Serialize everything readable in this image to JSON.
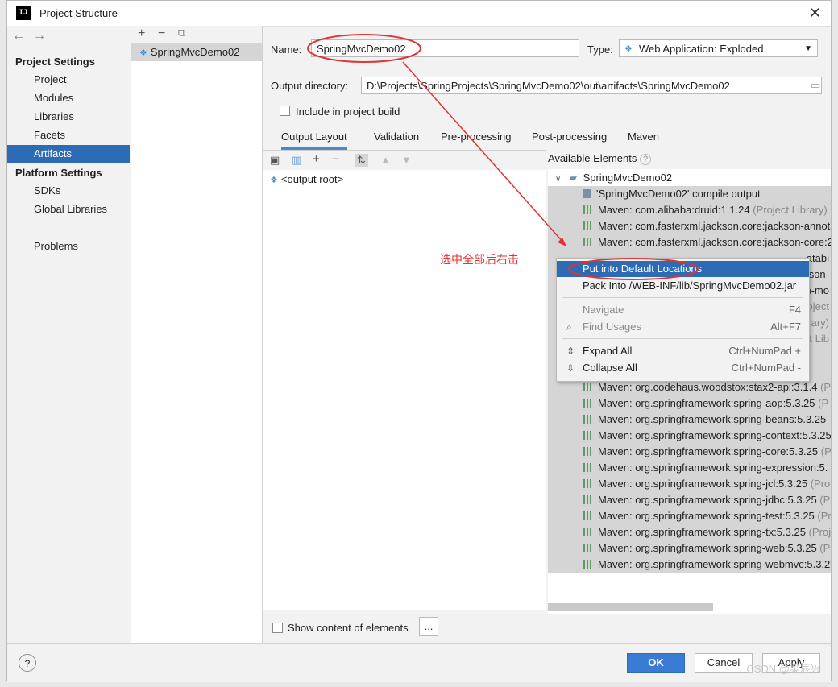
{
  "window": {
    "title": "Project Structure",
    "app_icon": "IJ"
  },
  "nav": {
    "project_settings": "Project Settings",
    "items_ps": [
      "Project",
      "Modules",
      "Libraries",
      "Facets",
      "Artifacts"
    ],
    "platform_settings": "Platform Settings",
    "items_platform": [
      "SDKs",
      "Global Libraries"
    ],
    "problems": "Problems",
    "selected": "Artifacts"
  },
  "artifact_list": {
    "item": "SpringMvcDemo02"
  },
  "form": {
    "name_label": "Name:",
    "name_value": "SpringMvcDemo02",
    "type_label": "Type:",
    "type_value": "Web Application: Exploded",
    "output_label": "Output directory:",
    "output_value": "D:\\Projects\\SpringProjects\\SpringMvcDemo02\\out\\artifacts\\SpringMvcDemo02",
    "include_label": "Include in project build"
  },
  "tabs": [
    "Output Layout",
    "Validation",
    "Pre-processing",
    "Post-processing",
    "Maven"
  ],
  "layout": {
    "root": "<output root>"
  },
  "available": {
    "label": "Available Elements",
    "project": "SpringMvcDemo02",
    "rows": [
      {
        "text": "'SpringMvcDemo02' compile output",
        "suffix": ""
      },
      {
        "text": "Maven: com.alibaba:druid:1.1.24",
        "suffix": " (Project Library)"
      },
      {
        "text": "Maven: com.fasterxml.jackson.core:jackson-annota",
        "suffix": ""
      },
      {
        "text": "Maven: com.fasterxml.jackson.core:jackson-core:2",
        "suffix": ""
      },
      {
        "text": "Maven: org.codehaus.woodstox:stax2-api:3.1.4",
        "suffix": " (Pr"
      },
      {
        "text": "Maven: org.springframework:spring-aop:5.3.25",
        "suffix": " (P"
      },
      {
        "text": "Maven: org.springframework:spring-beans:5.3.25",
        "suffix": ""
      },
      {
        "text": "Maven: org.springframework:spring-context:5.3.25",
        "suffix": ""
      },
      {
        "text": "Maven: org.springframework:spring-core:5.3.25",
        "suffix": " (Pr"
      },
      {
        "text": "Maven: org.springframework:spring-expression:5.",
        "suffix": ""
      },
      {
        "text": "Maven: org.springframework:spring-jcl:5.3.25",
        "suffix": " (Pro"
      },
      {
        "text": "Maven: org.springframework:spring-jdbc:5.3.25",
        "suffix": " (P"
      },
      {
        "text": "Maven: org.springframework:spring-test:5.3.25",
        "suffix": " (Pr"
      },
      {
        "text": "Maven: org.springframework:spring-tx:5.3.25",
        "suffix": " (Proj"
      },
      {
        "text": "Maven: org.springframework:spring-web:5.3.25",
        "suffix": " (Pr"
      },
      {
        "text": "Maven: org.springframework:spring-webmvc:5.3.2",
        "suffix": ""
      }
    ],
    "peek": [
      "atabi",
      "kson-",
      "n-mo",
      "roject",
      "rary)",
      "ct Lib"
    ]
  },
  "context_menu": {
    "put_default": "Put into Default Locations",
    "pack_into": "Pack Into /WEB-INF/lib/SpringMvcDemo02.jar",
    "navigate": "Navigate",
    "navigate_sc": "F4",
    "find_usages": "Find Usages",
    "find_usages_sc": "Alt+F7",
    "expand_all": "Expand All",
    "expand_sc": "Ctrl+NumPad +",
    "collapse_all": "Collapse All",
    "collapse_sc": "Ctrl+NumPad -"
  },
  "show_content": "Show content of elements",
  "ellipsis": "...",
  "buttons": {
    "ok": "OK",
    "cancel": "Cancel",
    "apply": "Apply",
    "help": "?"
  },
  "annotation": "选中全部后右击",
  "watermark": "CSDN @梁辰兴",
  "colors": {
    "selection": "#2d6cb4",
    "annotation": "#e03434",
    "ok": "#3a7bd5"
  }
}
